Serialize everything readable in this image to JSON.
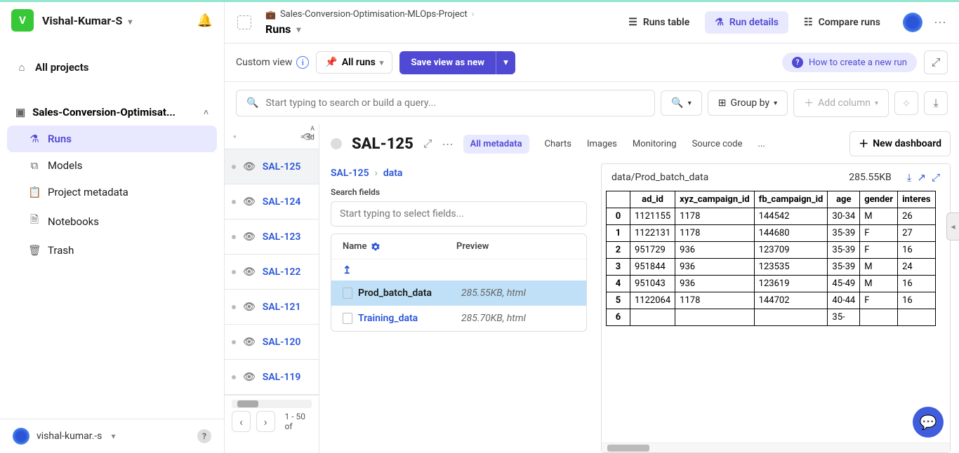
{
  "topbar": {
    "username": "Vishal-Kumar-S",
    "avatar_letter": "V"
  },
  "sidebar": {
    "all_projects": "All projects",
    "project_name": "Sales-Conversion-Optimisat...",
    "items": [
      {
        "label": "Runs",
        "active": true
      },
      {
        "label": "Models"
      },
      {
        "label": "Project metadata"
      },
      {
        "label": "Notebooks"
      },
      {
        "label": "Trash"
      }
    ],
    "bottom_user": "vishal-kumar.-s"
  },
  "content_header": {
    "breadcrumb_project": "Sales-Conversion-Optimisation-MLOps-Project",
    "runs_label": "Runs",
    "tabs": {
      "runs_table": "Runs table",
      "run_details": "Run details",
      "compare_runs": "Compare runs"
    }
  },
  "toolbar": {
    "custom_view": "Custom view",
    "all_runs": "All runs",
    "save_view": "Save view as new",
    "how_to": "How to create a new run"
  },
  "query": {
    "placeholder": "Start typing to search or build a query...",
    "group_by": "Group by",
    "add_column": "Add column"
  },
  "runs_list": {
    "id_label": "Id",
    "items": [
      "SAL-125",
      "SAL-124",
      "SAL-123",
      "SAL-122",
      "SAL-121",
      "SAL-120",
      "SAL-119"
    ],
    "pagination": "1 - 50 of"
  },
  "run_detail": {
    "title": "SAL-125",
    "tabs": [
      "All metadata",
      "Charts",
      "Images",
      "Monitoring",
      "Source code",
      "..."
    ],
    "new_dashboard": "New dashboard",
    "breadcrumb_run": "SAL-125",
    "breadcrumb_data": "data",
    "search_fields_label": "Search fields",
    "search_fields_placeholder": "Start typing to select fields...",
    "files_header_name": "Name",
    "files_header_preview": "Preview",
    "files": [
      {
        "name": "Prod_batch_data",
        "preview": "285.55KB, html",
        "selected": true
      },
      {
        "name": "Training_data",
        "preview": "285.70KB, html",
        "selected": false
      }
    ]
  },
  "preview": {
    "path": "data/Prod_batch_data",
    "size": "285.55KB",
    "columns": [
      "",
      "ad_id",
      "xyz_campaign_id",
      "fb_campaign_id",
      "age",
      "gender",
      "interes"
    ],
    "rows": [
      [
        "0",
        "1121155",
        "1178",
        "144542",
        "30-34",
        "M",
        "26"
      ],
      [
        "1",
        "1122131",
        "1178",
        "144680",
        "35-39",
        "F",
        "27"
      ],
      [
        "2",
        "951729",
        "936",
        "123709",
        "35-39",
        "F",
        "16"
      ],
      [
        "3",
        "951844",
        "936",
        "123535",
        "35-39",
        "M",
        "24"
      ],
      [
        "4",
        "951043",
        "936",
        "123619",
        "45-49",
        "M",
        "16"
      ],
      [
        "5",
        "1122064",
        "1178",
        "144702",
        "40-44",
        "F",
        "16"
      ],
      [
        "6",
        "",
        "",
        "",
        "35-",
        "",
        ""
      ]
    ]
  }
}
